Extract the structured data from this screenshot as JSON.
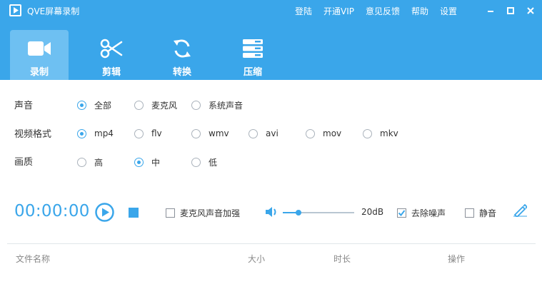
{
  "app": {
    "title": "QVE屏幕录制"
  },
  "top_links": [
    "登陆",
    "开通VIP",
    "意见反馈",
    "帮助",
    "设置"
  ],
  "tabs": [
    {
      "label": "录制",
      "icon": "video-camera-icon",
      "active": true
    },
    {
      "label": "剪辑",
      "icon": "scissors-icon",
      "active": false
    },
    {
      "label": "转换",
      "icon": "convert-icon",
      "active": false
    },
    {
      "label": "压缩",
      "icon": "compress-icon",
      "active": false
    }
  ],
  "settings": {
    "audio": {
      "label": "声音",
      "options": [
        "全部",
        "麦克风",
        "系统声音"
      ],
      "selected": "全部"
    },
    "format": {
      "label": "视频格式",
      "options": [
        "mp4",
        "flv",
        "wmv",
        "avi",
        "mov",
        "mkv"
      ],
      "selected": "mp4"
    },
    "quality": {
      "label": "画质",
      "options": [
        "高",
        "中",
        "低"
      ],
      "selected": "中"
    }
  },
  "controls": {
    "timer": "00:00:00",
    "mic_boost": {
      "label": "麦克风声音加强",
      "checked": false
    },
    "volume": {
      "value": 0.22,
      "display": "20dB"
    },
    "denoise": {
      "label": "去除噪声",
      "checked": true
    },
    "mute": {
      "label": "静音",
      "checked": false
    }
  },
  "table": {
    "columns": [
      "文件名称",
      "大小",
      "时长",
      "操作"
    ]
  },
  "colors": {
    "accent": "#3aa6ea",
    "active_tab": "#6ec0f2"
  }
}
